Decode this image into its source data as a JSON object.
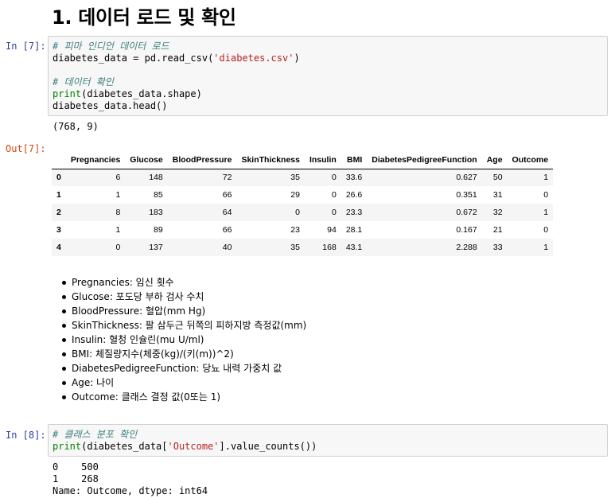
{
  "heading": "1. 데이터 로드 및 확인",
  "cells": {
    "in7": {
      "prompt": "In [7]:",
      "lines": [
        [
          {
            "t": "# 피마 인디언 데이터 로드",
            "c": "comment"
          }
        ],
        [
          {
            "t": "diabetes_data = pd.read_csv(",
            "c": "plain"
          },
          {
            "t": "'diabetes.csv'",
            "c": "string"
          },
          {
            "t": ")",
            "c": "plain"
          }
        ],
        [],
        [
          {
            "t": "# 데이터 확인",
            "c": "comment"
          }
        ],
        [
          {
            "t": "print",
            "c": "builtin"
          },
          {
            "t": "(diabetes_data.shape)",
            "c": "plain"
          }
        ],
        [
          {
            "t": "diabetes_data.head()",
            "c": "plain"
          }
        ]
      ],
      "stdout": "(768, 9)"
    },
    "out7": {
      "prompt": "Out[7]:",
      "columns": [
        "",
        "Pregnancies",
        "Glucose",
        "BloodPressure",
        "SkinThickness",
        "Insulin",
        "BMI",
        "DiabetesPedigreeFunction",
        "Age",
        "Outcome"
      ],
      "rows": [
        [
          "0",
          "6",
          "148",
          "72",
          "35",
          "0",
          "33.6",
          "0.627",
          "50",
          "1"
        ],
        [
          "1",
          "1",
          "85",
          "66",
          "29",
          "0",
          "26.6",
          "0.351",
          "31",
          "0"
        ],
        [
          "2",
          "8",
          "183",
          "64",
          "0",
          "0",
          "23.3",
          "0.672",
          "32",
          "1"
        ],
        [
          "3",
          "1",
          "89",
          "66",
          "23",
          "94",
          "28.1",
          "0.167",
          "21",
          "0"
        ],
        [
          "4",
          "0",
          "137",
          "40",
          "35",
          "168",
          "43.1",
          "2.288",
          "33",
          "1"
        ]
      ]
    },
    "in8": {
      "prompt": "In [8]:",
      "lines": [
        [
          {
            "t": "# 클래스 분포 확인",
            "c": "comment"
          }
        ],
        [
          {
            "t": "print",
            "c": "builtin"
          },
          {
            "t": "(diabetes_data[",
            "c": "plain"
          },
          {
            "t": "'Outcome'",
            "c": "string"
          },
          {
            "t": "].value_counts())",
            "c": "plain"
          }
        ]
      ],
      "stdout": "0    500\n1    268\nName: Outcome, dtype: int64"
    }
  },
  "descriptions": [
    "Pregnancies: 임신 횟수",
    "Glucose: 포도당 부하 검사 수치",
    "BloodPressure: 혈압(mm Hg)",
    "SkinThickness: 팔 삼두근 뒤쪽의 피하지방 측정값(mm)",
    "Insulin: 혈청 인슐린(mu U/ml)",
    "BMI: 체질량지수(체중(kg)/(키(m))^2)",
    "DiabetesPedigreeFunction: 당뇨 내력 가중치 값",
    "Age: 나이",
    "Outcome: 클래스 결정 값(0또는 1)"
  ],
  "colors": {
    "in_prompt": "#303F9F",
    "out_prompt": "#D84315",
    "comment": "#408080",
    "builtin": "#008000",
    "string": "#BA2121"
  }
}
